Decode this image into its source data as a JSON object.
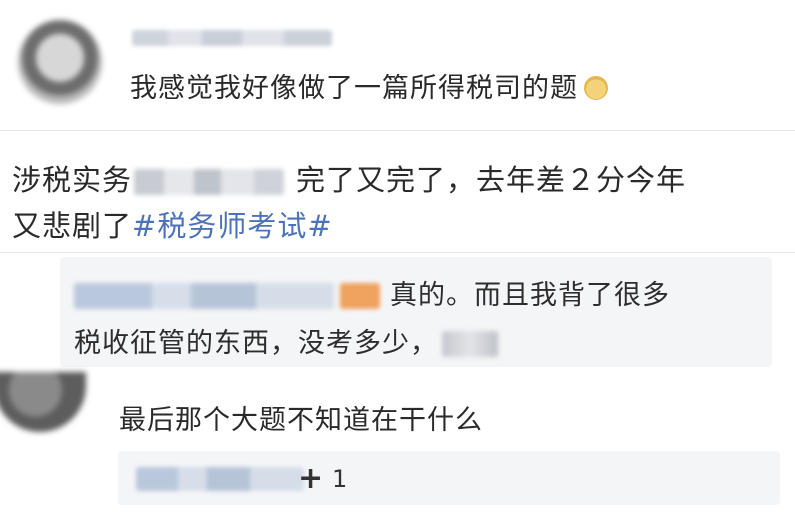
{
  "comment1": {
    "text": "我感觉我好像做了一篇所得税司的题"
  },
  "post": {
    "line1_prefix": "涉税实务",
    "line1_suffix": "完了又完了，去年差２分今年",
    "line2_prefix": "又悲剧了",
    "hashtag": "#税务师考试#"
  },
  "quote": {
    "line1": "真的。而且我背了很多",
    "line2": "税收征管的东西，没考多少，"
  },
  "comment2": {
    "text": "最后那个大题不知道在干什么"
  },
  "reaction": {
    "plus": "+",
    "count": "1"
  },
  "colors": {
    "hashtag": "#4e72b9",
    "reply_box": "#f4f5f7",
    "separator": "#e7e7ea"
  }
}
